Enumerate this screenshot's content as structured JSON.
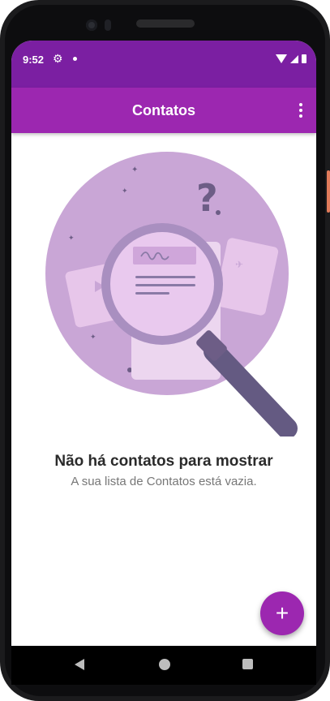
{
  "status": {
    "time": "9:52",
    "icons": [
      "gear-icon",
      "notification-dot-icon",
      "wifi-icon",
      "signal-icon",
      "battery-icon"
    ]
  },
  "appbar": {
    "title": "Contatos",
    "menu_icon": "more-vert-icon"
  },
  "empty_state": {
    "title": "Não há contatos para mostrar",
    "subtitle": "A sua lista de Contatos está vazia.",
    "illustration_icon": "magnifying-glass-search-icon"
  },
  "fab": {
    "label": "+",
    "icon": "add-icon"
  },
  "navbar": {
    "icons": [
      "back-icon",
      "home-icon",
      "recents-icon"
    ]
  },
  "colors": {
    "primary": "#9c27b0",
    "primary_dark": "#7b1fa2",
    "illustration_circle": "#c9a6d6",
    "illustration_lens": "#e9c9ee",
    "handle": "#645a82"
  }
}
